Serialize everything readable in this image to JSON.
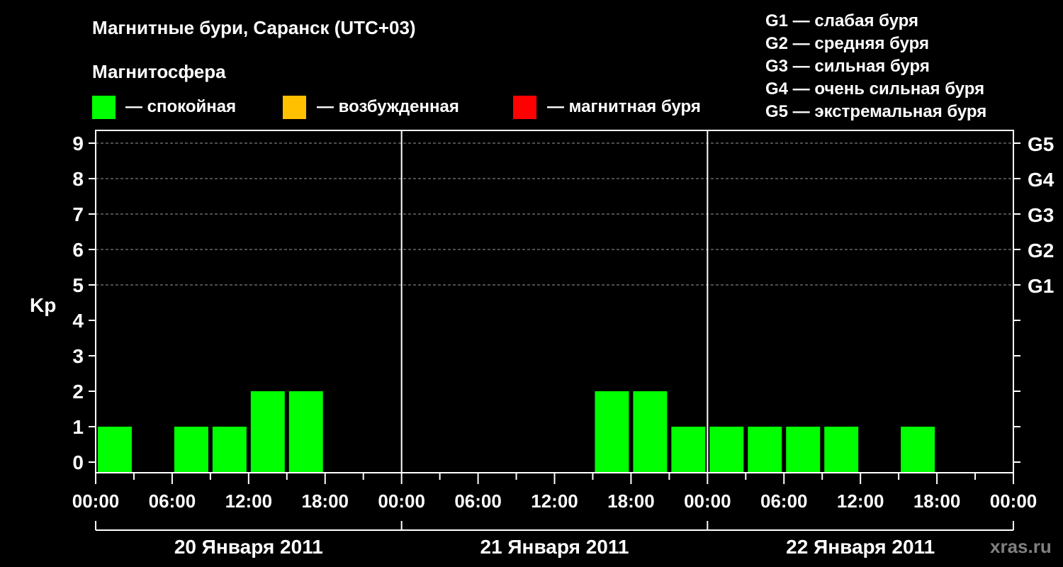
{
  "chart_data": {
    "type": "bar",
    "title": "Магнитные бури, Саранск (UTC+03)",
    "legend_title": "Магнитосфера",
    "legend": [
      {
        "label": "— спокойная",
        "color": "#00ff00"
      },
      {
        "label": "— возбужденная",
        "color": "#ffc000"
      },
      {
        "label": "— магнитная буря",
        "color": "#ff0000"
      }
    ],
    "storm_scale": [
      "G1 — слабая буря",
      "G2 — средняя буря",
      "G3 — сильная буря",
      "G4 — очень сильная буря",
      "G5 — экстремальная буря"
    ],
    "ylabel": "Kp",
    "ylim": [
      0,
      9
    ],
    "yticks": [
      "0",
      "1",
      "2",
      "3",
      "4",
      "5",
      "6",
      "7",
      "8",
      "9"
    ],
    "right_ticks": [
      {
        "kp": 5,
        "label": "G1"
      },
      {
        "kp": 6,
        "label": "G2"
      },
      {
        "kp": 7,
        "label": "G3"
      },
      {
        "kp": 8,
        "label": "G4"
      },
      {
        "kp": 9,
        "label": "G5"
      }
    ],
    "xtick_labels": [
      "00:00",
      "06:00",
      "12:00",
      "18:00",
      "00:00",
      "06:00",
      "12:00",
      "18:00",
      "00:00",
      "06:00",
      "12:00",
      "18:00",
      "00:00"
    ],
    "days": [
      "20 Января 2011",
      "21 Января 2011",
      "22 Января 2011"
    ],
    "grid_dashed_levels": [
      5,
      6,
      7,
      8,
      9
    ],
    "values": [
      1,
      0,
      1,
      1,
      2,
      2,
      0,
      0,
      0,
      0,
      0,
      0,
      0,
      2,
      2,
      1,
      1,
      1,
      1,
      1,
      0,
      1,
      0,
      0
    ],
    "bar_color": "#00ff00"
  },
  "watermark": "xras.ru"
}
